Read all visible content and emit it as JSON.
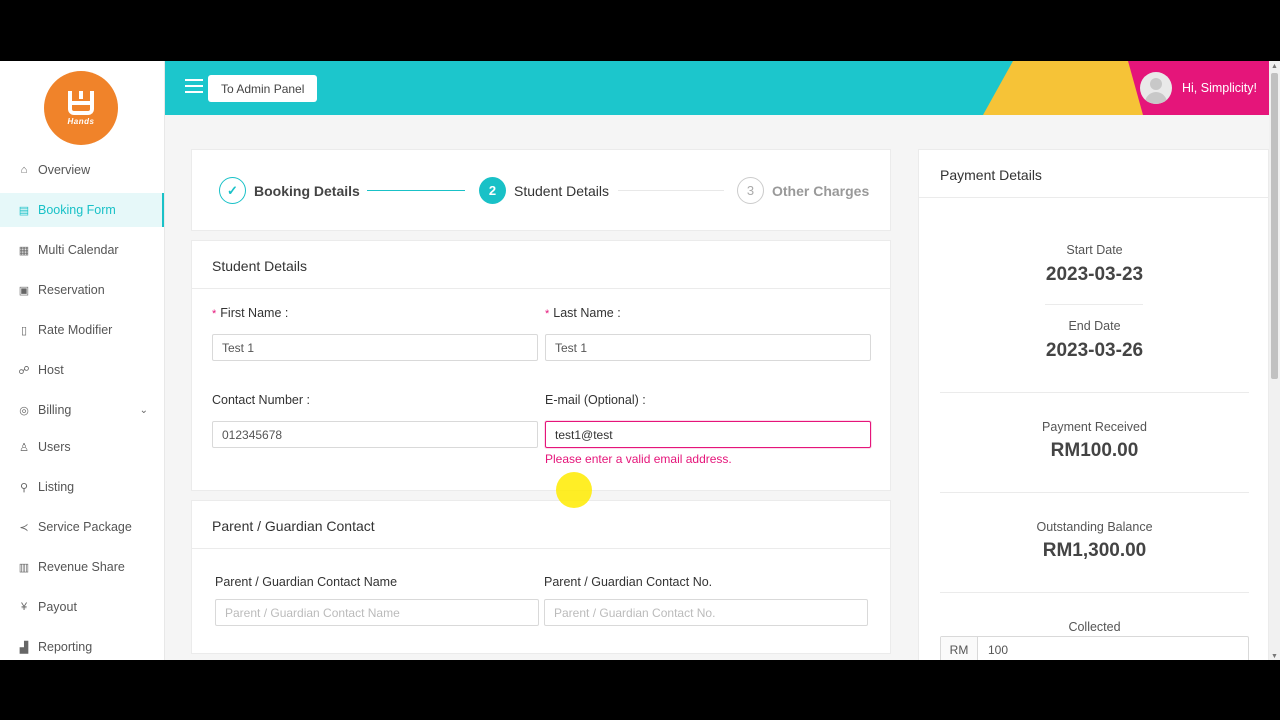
{
  "logo": {
    "text": "Hands"
  },
  "sidebar": {
    "items": [
      {
        "label": "Overview",
        "icon": "home-icon"
      },
      {
        "label": "Booking Form",
        "icon": "form-icon",
        "active": true
      },
      {
        "label": "Multi Calendar",
        "icon": "calendar-icon"
      },
      {
        "label": "Reservation",
        "icon": "reservation-icon"
      },
      {
        "label": "Rate Modifier",
        "icon": "rate-modifier-icon"
      },
      {
        "label": "Host",
        "icon": "host-icon"
      },
      {
        "label": "Billing",
        "icon": "billing-icon",
        "expandable": true
      },
      {
        "label": "Users",
        "icon": "user-icon"
      },
      {
        "label": "Listing",
        "icon": "listing-icon"
      },
      {
        "label": "Service Package",
        "icon": "share-icon"
      },
      {
        "label": "Revenue Share",
        "icon": "revenue-icon"
      },
      {
        "label": "Payout",
        "icon": "payout-icon"
      },
      {
        "label": "Reporting",
        "icon": "chart-icon"
      }
    ]
  },
  "header": {
    "admin_button": "To Admin Panel",
    "greeting": "Hi, Simplicity!",
    "colors": {
      "primary": "#1cc6cc",
      "yellow": "#f6c337",
      "pink": "#e5157a"
    }
  },
  "steps": [
    {
      "number": "",
      "label": "Booking Details",
      "status": "done"
    },
    {
      "number": "2",
      "label": "Student Details",
      "status": "active"
    },
    {
      "number": "3",
      "label": "Other Charges",
      "status": "pending"
    }
  ],
  "student": {
    "title": "Student Details",
    "first_name": {
      "label": "First Name",
      "value": "Test 1"
    },
    "last_name": {
      "label": "Last Name",
      "value": "Test 1"
    },
    "contact": {
      "label": "Contact Number",
      "value": "012345678"
    },
    "email": {
      "label": "E-mail (Optional)",
      "value": "test1@test",
      "error": "Please enter a valid email address."
    }
  },
  "parent": {
    "title": "Parent / Guardian Contact",
    "name": {
      "label": "Parent / Guardian Contact Name",
      "placeholder": "Parent / Guardian Contact Name"
    },
    "phone": {
      "label": "Parent / Guardian Contact No.",
      "placeholder": "Parent / Guardian Contact No."
    }
  },
  "payment": {
    "title": "Payment Details",
    "start_label": "Start Date",
    "start_value": "2023-03-23",
    "end_label": "End Date",
    "end_value": "2023-03-26",
    "received_label": "Payment Received",
    "received_value": "RM100.00",
    "outstanding_label": "Outstanding Balance",
    "outstanding_value": "RM1,300.00",
    "collected_label": "Collected",
    "collected_prefix": "RM",
    "collected_value": "100"
  }
}
